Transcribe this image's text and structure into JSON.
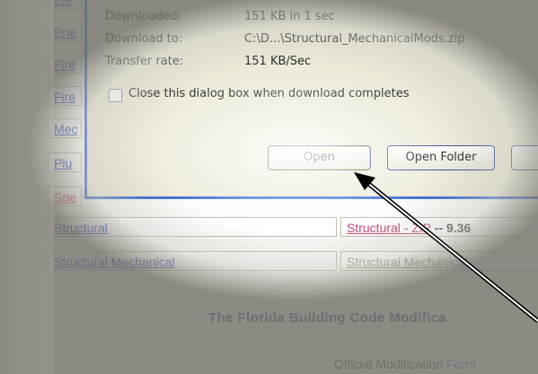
{
  "page": {
    "side_links": [
      "Ele",
      "Ene",
      "Fire",
      "Fire",
      "Mec",
      "Plu",
      "Spe"
    ],
    "rows": [
      {
        "left": "Structural",
        "right_link": "Structural - ZIP",
        "right_size": "-- 9.36"
      },
      {
        "left": "Structural Mechanical",
        "right_link": "Structural Mechanical",
        "right_size": ""
      }
    ],
    "heading": "The Florida Building Code Modifica",
    "subline_prefix": "Official Modification ",
    "subline_link": "Form"
  },
  "dialog": {
    "downloaded_label": "Downloaded:",
    "downloaded_value": "151 KB in 1 sec",
    "download_to_label": "Download to:",
    "download_to_value": "C:\\D...\\Structural_MechanicalMods.zip",
    "rate_label": "Transfer rate:",
    "rate_value": "151 KB/Sec",
    "close_checkbox_label": "Close this dialog box when download completes",
    "close_checkbox_checked": false,
    "open_button": "Open",
    "open_folder_button": "Open Folder",
    "cancel_button": ""
  },
  "colors": {
    "link": "#1a3fc2",
    "visited_link": "#c43a6a",
    "dialog_border": "#2a5fd0",
    "dialog_bg": "#ece9d8",
    "heading": "#2a4a86"
  }
}
